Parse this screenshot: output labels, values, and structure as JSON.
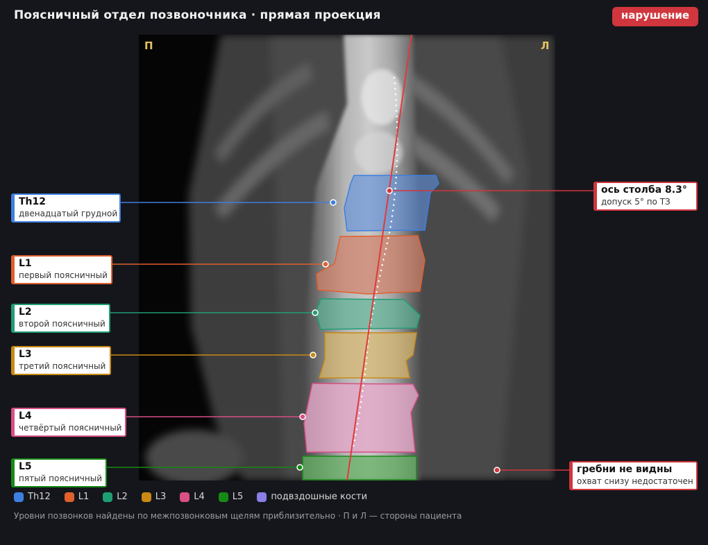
{
  "header": {
    "title": "Поясничный отдел позвоночника · прямая проекция",
    "status_badge": "нарушение",
    "status_color": "#d0363d"
  },
  "image": {
    "side_right_patient": "П",
    "side_left_patient": "Л"
  },
  "vertebrae": [
    {
      "code": "Th12",
      "name": "двенадцатый грудной",
      "color": "#3d7fe0"
    },
    {
      "code": "L1",
      "name": "первый поясничный",
      "color": "#e0602e"
    },
    {
      "code": "L2",
      "name": "второй поясничный",
      "color": "#1f9e74"
    },
    {
      "code": "L3",
      "name": "третий поясничный",
      "color": "#c98a14"
    },
    {
      "code": "L4",
      "name": "четвёртый поясничный",
      "color": "#d94f86"
    },
    {
      "code": "L5",
      "name": "пятый поясничный",
      "color": "#168a16"
    }
  ],
  "annotations": {
    "axis": {
      "title": "ось столба 8.3°",
      "subtitle": "допуск 5° по ТЗ",
      "color": "#d0363d"
    },
    "iliac": {
      "title": "гребни не видны",
      "subtitle": "охват снизу недостаточен",
      "color": "#d0363d"
    }
  },
  "legend": [
    {
      "label": "Th12",
      "color": "#3d7fe0"
    },
    {
      "label": "L1",
      "color": "#e0602e"
    },
    {
      "label": "L2",
      "color": "#1f9e74"
    },
    {
      "label": "L3",
      "color": "#c98a14"
    },
    {
      "label": "L4",
      "color": "#d94f86"
    },
    {
      "label": "L5",
      "color": "#168a16"
    },
    {
      "label": "подвздошные кости",
      "color": "#8a7fe6"
    }
  ],
  "footnote": "Уровни позвонков найдены по межпозвонковым щелям приблизительно · П и Л — стороны пациента"
}
